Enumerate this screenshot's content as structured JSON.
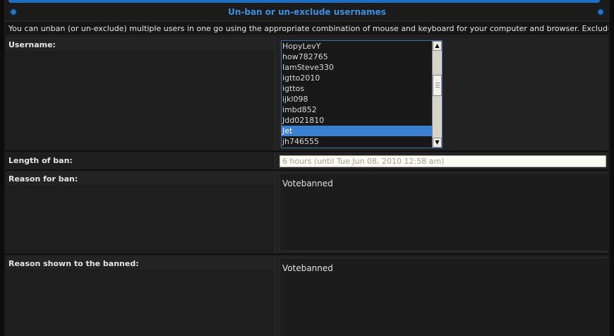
{
  "panel": {
    "title": "Un-ban or un-exclude usernames",
    "intro": "You can unban (or un-exclude) multiple users in one go using the appropriate combination of mouse and keyboard for your computer and browser. Excluded users are emphasised."
  },
  "form": {
    "username_label": "Username:",
    "users": [
      "HopyLevY",
      "how782765",
      "IamSteve330",
      "igtto2010",
      "igttos",
      "ijkl098",
      "imbd852",
      "Jdd021810",
      "Jet",
      "jh746555"
    ],
    "selected_user": "Jet",
    "length_label": "Length of ban:",
    "length_value": "6 hours (until Tue Jun 08, 2010 12:58 am)",
    "reason_label": "Reason for ban:",
    "reason_value": "Votebanned",
    "shown_label": "Reason shown to the banned:",
    "shown_value": "Votebanned"
  },
  "colors": {
    "accent": "#3e8fe0",
    "selection": "#3b80cf"
  }
}
